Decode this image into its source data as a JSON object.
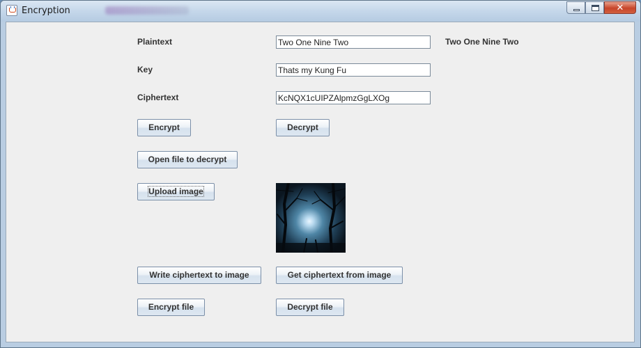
{
  "window": {
    "title": "Encryption"
  },
  "form": {
    "plaintext_label": "Plaintext",
    "plaintext_value": "Two One Nine Two",
    "plaintext_echo": "Two One Nine Two",
    "key_label": "Key",
    "key_value": "Thats my Kung Fu",
    "ciphertext_label": "Ciphertext",
    "ciphertext_value": "KcNQX1cUIPZAlpmzGgLXOg"
  },
  "buttons": {
    "encrypt": "Encrypt",
    "decrypt": "Decrypt",
    "open_file_to_decrypt": "Open file to decrypt",
    "upload_image": "Upload image",
    "write_ciphertext_to_image": "Write ciphertext to image",
    "get_ciphertext_from_image": "Get ciphertext from image",
    "encrypt_file": "Encrypt file",
    "decrypt_file": "Decrypt file"
  },
  "icons": {
    "app": "java-cup-icon",
    "minimize": "minimize-icon",
    "maximize": "maximize-icon",
    "close": "close-icon"
  },
  "colors": {
    "close_button": "#c7452a",
    "panel_background": "#efefef",
    "title_bar": "#c5d7ea"
  }
}
